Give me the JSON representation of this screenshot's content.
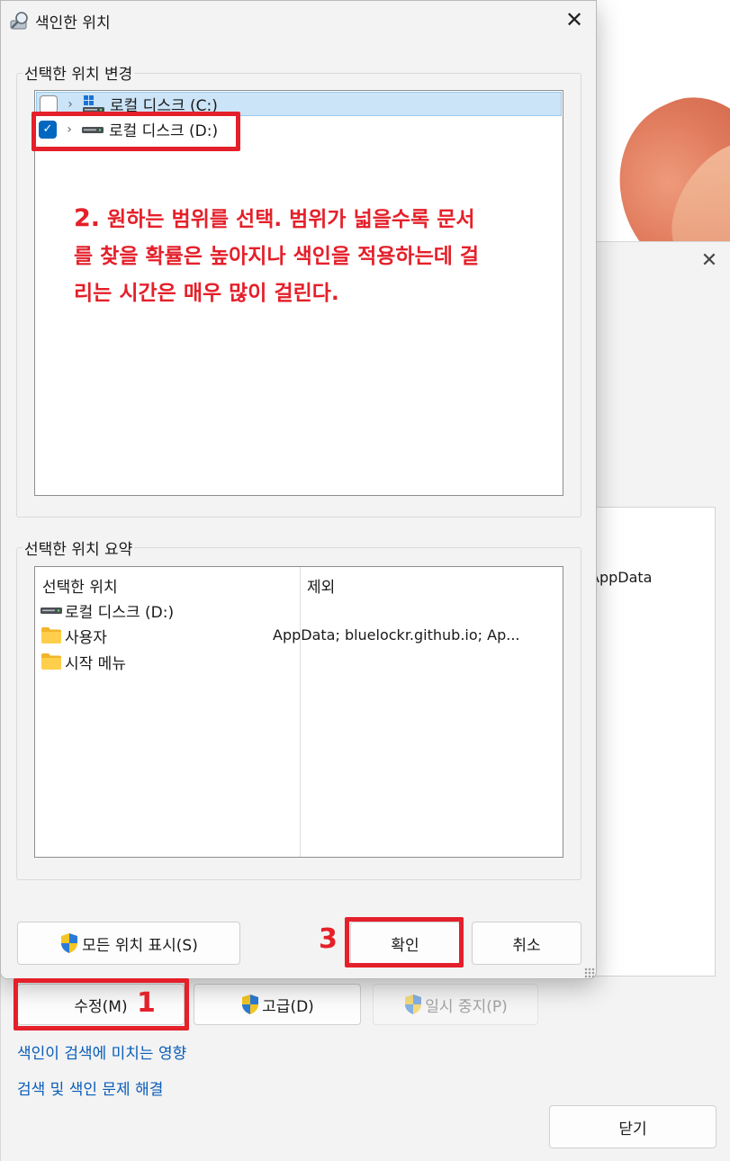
{
  "parent": {
    "close_glyph": "✕",
    "exclude_partial": "AppData",
    "modify_button": "수정(M)",
    "advanced_button": "고급(D)",
    "pause_button": "일시 중지(P)",
    "link_indexing_effect": "색인이 검색에 미치는 영향",
    "link_troubleshoot": "검색 및 색인 문제 해결",
    "close_button": "닫기"
  },
  "dialog": {
    "title": "색인한 위치",
    "close_glyph": "✕",
    "change_group_title": "선택한 위치 변경",
    "tree": [
      {
        "label": "로컬 디스크 (C:)",
        "checked": false,
        "selected": true,
        "icon": "windows-drive-icon"
      },
      {
        "label": "로컬 디스크 (D:)",
        "checked": true,
        "selected": false,
        "icon": "drive-icon"
      }
    ],
    "summary_group_title": "선택한 위치 요약",
    "summary_headers": {
      "location": "선택한 위치",
      "exclude": "제외"
    },
    "summary_rows": [
      {
        "label": "로컬 디스크 (D:)",
        "icon": "drive-icon"
      },
      {
        "label": "사용자",
        "icon": "folder-icon"
      },
      {
        "label": "시작 메뉴",
        "icon": "folder-icon"
      }
    ],
    "summary_exclude_value": "AppData; bluelockr.github.io; Ap...",
    "show_all_button": "모든 위치 표시(S)",
    "ok_button": "확인",
    "cancel_button": "취소"
  },
  "annotations": {
    "step1": "1",
    "step2_num": "2.",
    "step2_text": " 원하는 범위를 선택. 범위가 넓을수록 문서를 찾을 확률은 높아지나 색인을 적용하는데 걸리는 시간은 매우 많이 걸린다.",
    "step3": "3",
    "color": "#e4202a"
  },
  "colors": {
    "accent": "#0067c0",
    "link": "#0a5db8",
    "selection": "#cce4f7",
    "dialog_bg": "#f3f3f3"
  }
}
